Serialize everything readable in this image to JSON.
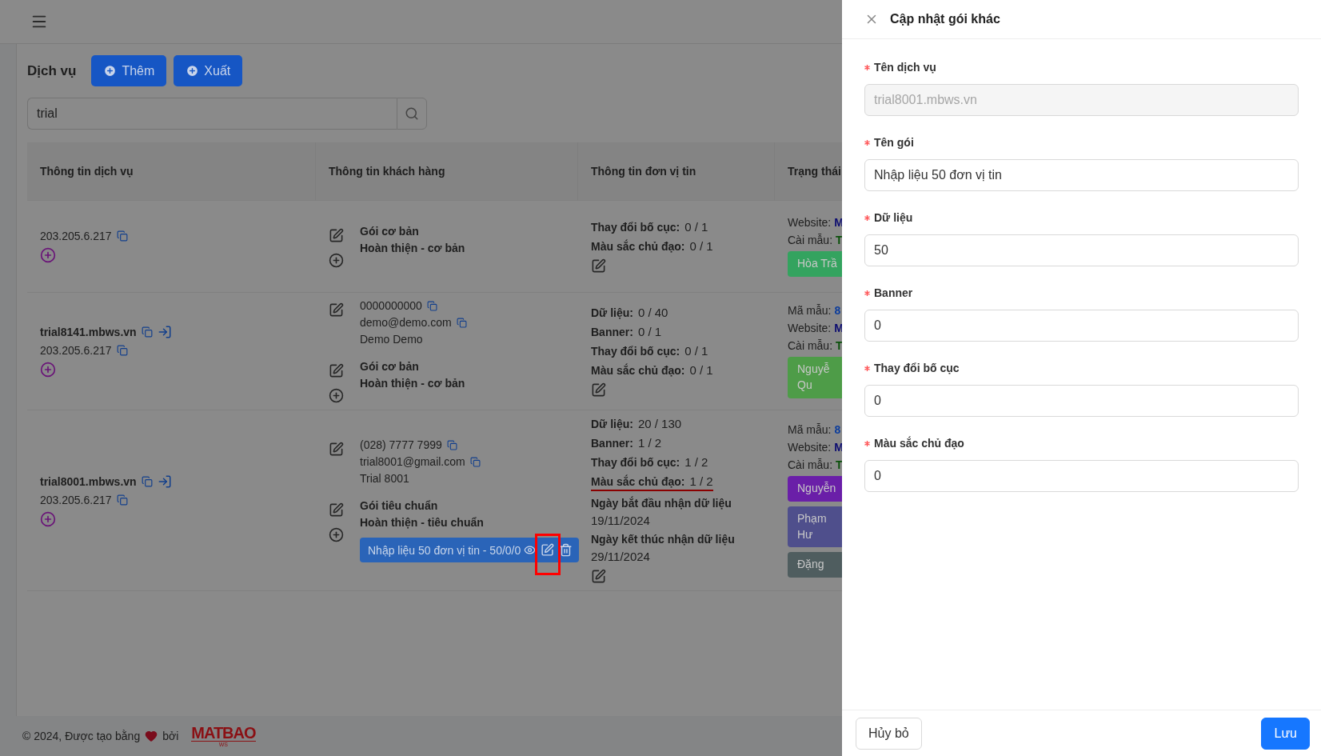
{
  "page": {
    "title": "Dịch vụ",
    "actions": [
      {
        "label": "Thêm"
      },
      {
        "label": "Xuất"
      }
    ]
  },
  "search": {
    "value": "trial"
  },
  "table": {
    "columns": [
      "Thông tin dịch vụ",
      "Thông tin khách hàng",
      "Thông tin đơn vị tin",
      "Trạng thái"
    ],
    "rows": [
      {
        "ip": "203.205.6.217",
        "package": {
          "name": "Gói cơ bản",
          "tier": "Hoàn thiện - cơ bản"
        },
        "stats": [
          {
            "label": "Thay đổi bố cục:",
            "value": "0 / 1",
            "highlighted": false
          },
          {
            "label": "Màu sắc chủ đạo:",
            "value": "0 / 1",
            "highlighted": false
          }
        ],
        "status": {
          "lines": [
            {
              "label": "Website:",
              "value": "M",
              "color": "#0c0c70"
            },
            {
              "label": "Cài mẫu:",
              "value": "T",
              "color": "#0a500a"
            }
          ],
          "staff": [
            {
              "lines": [
                "Hòa Trầ"
              ],
              "color": "#34a35f"
            }
          ]
        }
      },
      {
        "domain": "trial8141.mbws.vn",
        "ip": "203.205.6.217",
        "contact": {
          "phone": "0000000000",
          "email": "demo@demo.com",
          "name": "Demo Demo"
        },
        "package": {
          "name": "Gói cơ bản",
          "tier": "Hoàn thiện - cơ bản"
        },
        "stats": [
          {
            "label": "Dữ liệu:",
            "value": "0 / 40",
            "highlighted": false
          },
          {
            "label": "Banner:",
            "value": "0 / 1",
            "highlighted": false
          },
          {
            "label": "Thay đổi bố cục:",
            "value": "0 / 1",
            "highlighted": false
          },
          {
            "label": "Màu sắc chủ đạo:",
            "value": "0 / 1",
            "highlighted": false
          }
        ],
        "status": {
          "lines": [
            {
              "label": "Mã mẫu:",
              "value": "8",
              "color": "#0b3c9c"
            },
            {
              "label": "Website:",
              "value": "M",
              "color": "#0c0c70"
            },
            {
              "label": "Cài mẫu:",
              "value": "T",
              "color": "#0a500a"
            }
          ],
          "staff": [
            {
              "lines": [
                "Nguyễ",
                "Qu"
              ],
              "color": "#4e9c48"
            }
          ]
        }
      },
      {
        "domain": "trial8001.mbws.vn",
        "ip": "203.205.6.217",
        "contact": {
          "phone": "(028) 7777 7999",
          "email": "trial8001@gmail.com",
          "name": "Trial 8001"
        },
        "package": {
          "name": "Gói tiêu chuẩn",
          "tier": "Hoàn thiện - tiêu chuẩn"
        },
        "addons": [
          {
            "label": "Nhập liệu 50 đơn vị tin - 50/0/0",
            "highlighted": true
          }
        ],
        "stats": [
          {
            "label": "Dữ liệu:",
            "value": "20 / 130",
            "highlighted": false
          },
          {
            "label": "Banner:",
            "value": "1 / 2",
            "highlighted": false
          },
          {
            "label": "Thay đổi bố cục:",
            "value": "1 / 2",
            "highlighted": false
          },
          {
            "label": "Màu sắc chủ đạo:",
            "value": "1 / 2",
            "highlighted": true
          }
        ],
        "dates": [
          {
            "label": "Ngày bắt đầu nhận dữ liệu",
            "value": "19/11/2024"
          },
          {
            "label": "Ngày kết thúc nhận dữ liệu",
            "value": "29/11/2024"
          }
        ],
        "status": {
          "lines": [
            {
              "label": "Mã mẫu:",
              "value": "8",
              "color": "#0b3c9c"
            },
            {
              "label": "Website:",
              "value": "M",
              "color": "#0c0c70"
            },
            {
              "label": "Cài mẫu:",
              "value": "T",
              "color": "#0a500a"
            }
          ],
          "staff": [
            {
              "lines": [
                "Nguyễn"
              ],
              "color": "#6a1fa8"
            },
            {
              "lines": [
                "Phạm",
                "Hư"
              ],
              "color": "#4f4f8c"
            },
            {
              "lines": [
                "Đặng"
              ],
              "color": "#4f5d5f"
            }
          ]
        }
      }
    ]
  },
  "footer": {
    "text": "© 2024, Được tạo bằng",
    "by": "bởi",
    "logo": "MATBAO",
    "logo_sub": "WS"
  },
  "drawer": {
    "title": "Cập nhật gói khác",
    "fields": [
      {
        "label": "Tên dịch vụ",
        "value": "trial8001.mbws.vn",
        "required": true,
        "disabled": true
      },
      {
        "label": "Tên gói",
        "value": "Nhập liệu 50 đơn vị tin",
        "required": true,
        "disabled": false
      },
      {
        "label": "Dữ liệu",
        "value": "50",
        "required": true,
        "disabled": false
      },
      {
        "label": "Banner",
        "value": "0",
        "required": true,
        "disabled": false
      },
      {
        "label": "Thay đổi bố cục",
        "value": "0",
        "required": true,
        "disabled": false
      },
      {
        "label": "Màu sắc chủ đạo",
        "value": "0",
        "required": true,
        "disabled": false
      }
    ],
    "buttons": [
      {
        "label": "Hủy bỏ",
        "kind": "default"
      },
      {
        "label": "Lưu",
        "kind": "primary"
      }
    ]
  }
}
